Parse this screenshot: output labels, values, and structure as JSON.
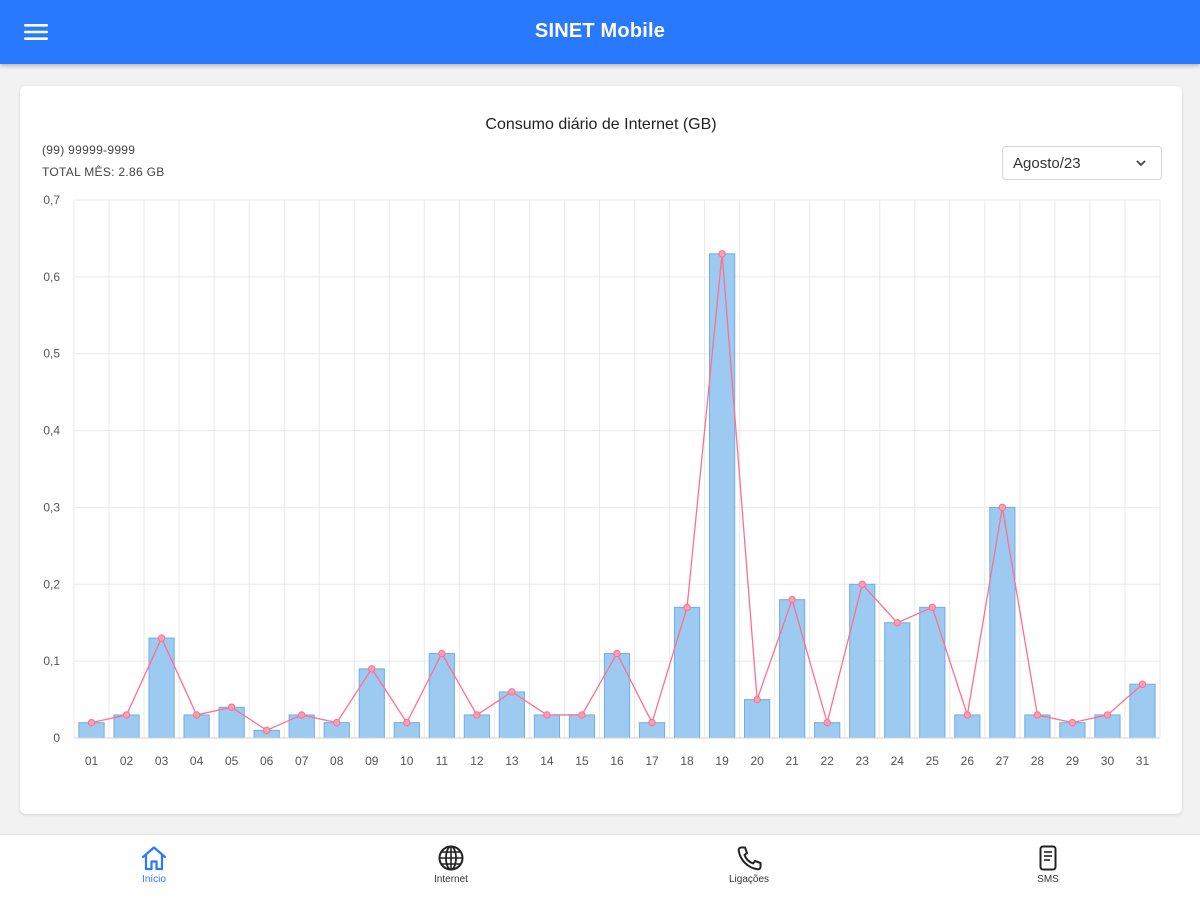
{
  "app": {
    "title": "SINET Mobile"
  },
  "icons": {
    "menu": "menu-icon",
    "dropdown": "chevron-down-icon"
  },
  "colors": {
    "accent": "#2979ff",
    "bar": "#9ccaf1",
    "bar_border": "#72aee6",
    "line": "#ff6f8e"
  },
  "card": {
    "phone": "(99) 99999-9999",
    "total": "TOTAL MÊS: 2.86 GB",
    "month_select": {
      "value": "Agosto/23"
    }
  },
  "chart_data": {
    "type": "bar",
    "title": "Consumo diário de Internet (GB)",
    "xlabel": "",
    "ylabel": "",
    "ylim": [
      0,
      0.7
    ],
    "yticks": [
      "0",
      "0,1",
      "0,2",
      "0,3",
      "0,4",
      "0,5",
      "0,6",
      "0,7"
    ],
    "grid": true,
    "categories": [
      "01",
      "02",
      "03",
      "04",
      "05",
      "06",
      "07",
      "08",
      "09",
      "10",
      "11",
      "12",
      "13",
      "14",
      "15",
      "16",
      "17",
      "18",
      "19",
      "20",
      "21",
      "22",
      "23",
      "24",
      "25",
      "26",
      "27",
      "28",
      "29",
      "30",
      "31"
    ],
    "series": [
      {
        "type": "bar",
        "values": [
          0.02,
          0.03,
          0.13,
          0.03,
          0.04,
          0.01,
          0.03,
          0.02,
          0.09,
          0.02,
          0.11,
          0.03,
          0.06,
          0.03,
          0.03,
          0.11,
          0.02,
          0.17,
          0.63,
          0.05,
          0.18,
          0.02,
          0.2,
          0.15,
          0.17,
          0.03,
          0.3,
          0.03,
          0.02,
          0.03,
          0.07
        ]
      },
      {
        "type": "line",
        "values": [
          0.02,
          0.03,
          0.13,
          0.03,
          0.04,
          0.01,
          0.03,
          0.02,
          0.09,
          0.02,
          0.11,
          0.03,
          0.06,
          0.03,
          0.03,
          0.11,
          0.02,
          0.17,
          0.63,
          0.05,
          0.18,
          0.02,
          0.2,
          0.15,
          0.17,
          0.03,
          0.3,
          0.03,
          0.02,
          0.03,
          0.07
        ]
      }
    ]
  },
  "bottom_nav": [
    {
      "label": "Início",
      "icon": "home-icon",
      "active": true
    },
    {
      "label": "Internet",
      "icon": "globe-icon",
      "active": false
    },
    {
      "label": "Ligações",
      "icon": "phone-icon",
      "active": false
    },
    {
      "label": "SMS",
      "icon": "sms-icon",
      "active": false
    }
  ]
}
